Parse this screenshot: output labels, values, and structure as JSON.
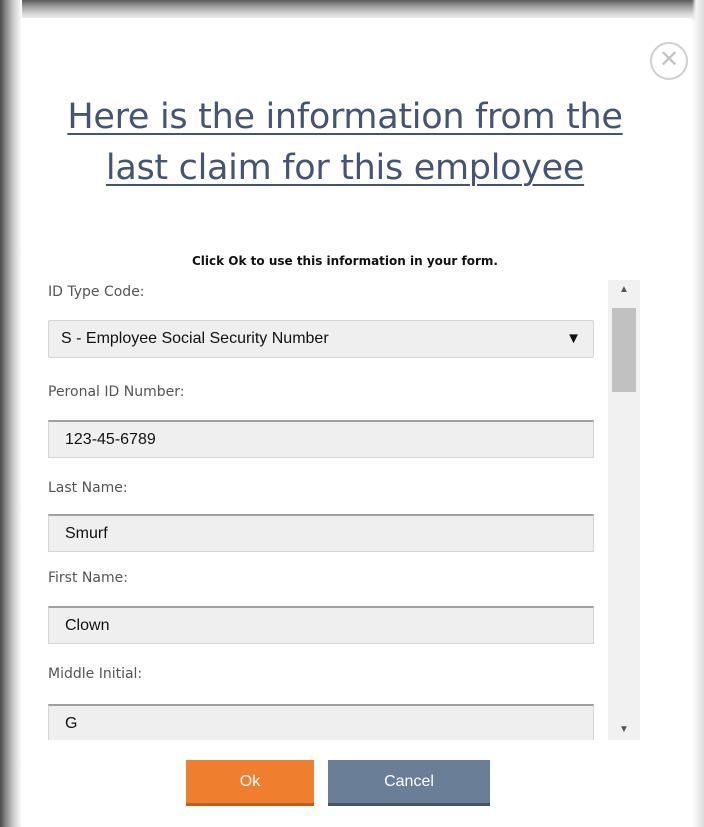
{
  "dialog": {
    "close_glyph": "✕",
    "title": "Here is the information from the last claim for this employee",
    "subtitle": "Click Ok to use this information in your form."
  },
  "form": {
    "id_type": {
      "label": "ID Type Code:",
      "value": "S - Employee Social Security Number",
      "arrow": "▼"
    },
    "personal_id": {
      "label": "Peronal ID Number:",
      "value": "123-45-6789"
    },
    "last_name": {
      "label": "Last Name:",
      "value": "Smurf"
    },
    "first_name": {
      "label": "First Name:",
      "value": "Clown"
    },
    "middle_initial": {
      "label": "Middle Initial:",
      "value": "G"
    }
  },
  "scrollbar": {
    "up": "▲",
    "down": "▼",
    "position": 0.0
  },
  "buttons": {
    "ok": "Ok",
    "cancel": "Cancel"
  },
  "colors": {
    "title": "#465374",
    "ok": "#ef7f2f",
    "cancel": "#6b7e98"
  },
  "icons": {
    "close": "close-icon",
    "select_arrow": "chevron-down-icon"
  }
}
